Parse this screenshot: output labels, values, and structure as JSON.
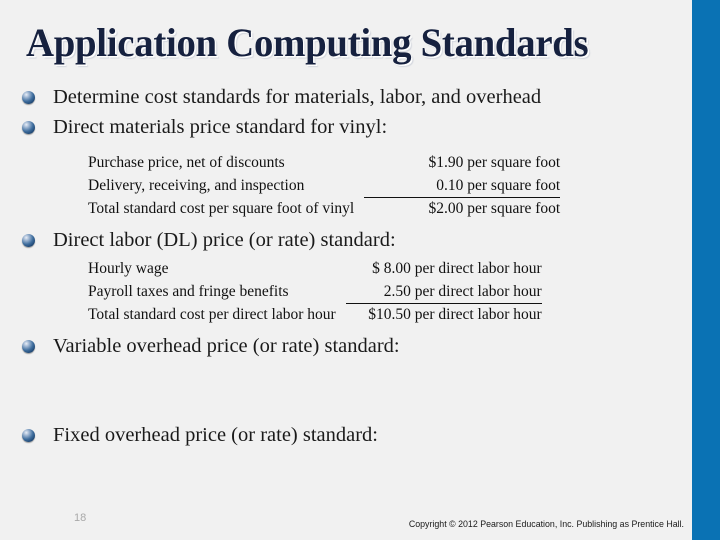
{
  "slide": {
    "title": "Application Computing Standards",
    "page_number": "18",
    "copyright": "Copyright © 2012 Pearson Education, Inc. Publishing as Prentice Hall.",
    "accent_color": "#0a72b4",
    "background_color": "#f1f1f1",
    "title_color": "#16213f"
  },
  "bullets": [
    {
      "text": "Determine cost standards for materials, labor, and overhead"
    },
    {
      "text": "Direct materials price standard for vinyl:"
    },
    {
      "text": "Direct labor (DL) price (or rate) standard:"
    },
    {
      "text": "Variable overhead price (or rate) standard:"
    },
    {
      "text": "Fixed overhead price (or rate) standard:"
    }
  ],
  "tables": [
    {
      "name": "direct-materials-price-standard",
      "rows": [
        {
          "label": "Purchase price, net of discounts",
          "value": "$1.90 per square foot",
          "ruled": false
        },
        {
          "label": "Delivery, receiving, and inspection",
          "value": "0.10 per square foot",
          "ruled": true
        },
        {
          "label": "Total standard cost per square foot of vinyl",
          "value": "$2.00 per square foot",
          "ruled": false
        }
      ]
    },
    {
      "name": "direct-labor-price-standard",
      "rows": [
        {
          "label": "Hourly wage",
          "value": "$ 8.00 per direct labor hour",
          "ruled": false
        },
        {
          "label": "Payroll taxes and fringe benefits",
          "value": "2.50 per direct labor hour",
          "ruled": true
        },
        {
          "label": "Total standard cost per direct labor hour",
          "value": "$10.50 per direct labor hour",
          "ruled": false
        }
      ]
    }
  ]
}
